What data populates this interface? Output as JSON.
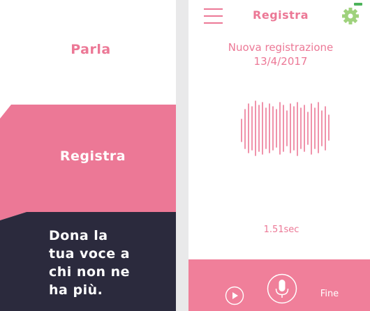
{
  "left_menu": {
    "items": [
      {
        "label": "Parla"
      },
      {
        "label": "Registra"
      },
      {
        "label": "Dona la tua voce a chi non ne ha più.",
        "lines": [
          "Dona la",
          "tua voce a",
          "chi non ne",
          "ha più."
        ]
      }
    ]
  },
  "screen": {
    "title": "Registra",
    "recording_name": "Nuova registrazione",
    "recording_date": "13/4/2017",
    "duration": "1.51sec",
    "finish_label": "Fine"
  },
  "icons": {
    "menu": "hamburger-icon",
    "settings": "gear-icon",
    "play": "play-icon",
    "mic": "microphone-icon"
  },
  "colors": {
    "accent_pink": "#ec7896",
    "bar_pink": "#f07f9a",
    "navy": "#2b2a3d",
    "gear_green": "#9fd27d"
  }
}
